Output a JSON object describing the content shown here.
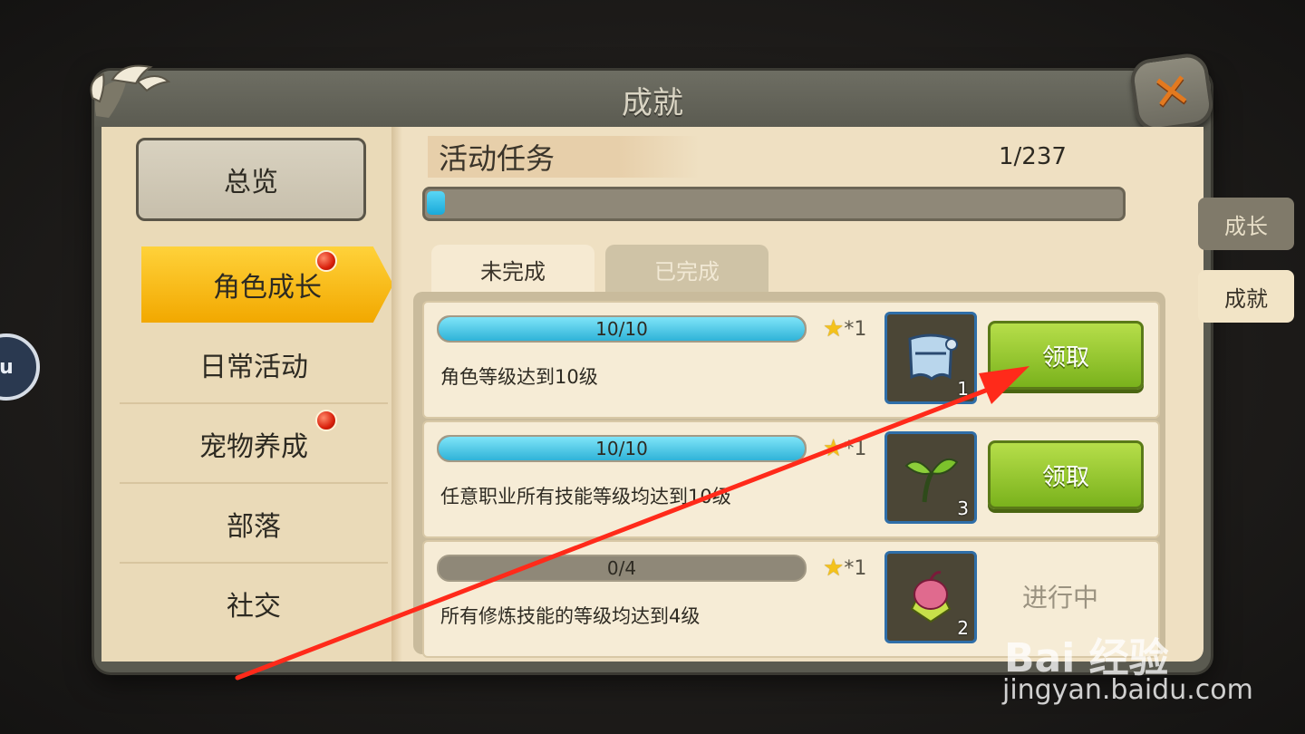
{
  "window": {
    "title": "成就"
  },
  "sidebar": {
    "overview_label": "总览",
    "items": [
      {
        "label": "角色成长",
        "active": true,
        "notification": true
      },
      {
        "label": "日常活动",
        "active": false,
        "notification": false
      },
      {
        "label": "宠物养成",
        "active": false,
        "notification": true
      },
      {
        "label": "部落",
        "active": false,
        "notification": false
      },
      {
        "label": "社交",
        "active": false,
        "notification": false
      }
    ]
  },
  "main": {
    "section_title": "活动任务",
    "progress_text": "1/237",
    "progress_value": 1,
    "progress_max": 237,
    "tabs": [
      {
        "label": "未完成",
        "active": true
      },
      {
        "label": "已完成",
        "active": false
      }
    ],
    "tasks": [
      {
        "progress_text": "10/10",
        "progress": 1.0,
        "description": "角色等级达到10级",
        "reward_text": "*1",
        "item_icon": "scroll-banner-icon",
        "item_count": "1",
        "action": "领取"
      },
      {
        "progress_text": "10/10",
        "progress": 1.0,
        "description": "任意职业所有技能等级均达到10级",
        "reward_text": "*1",
        "item_icon": "sprout-icon",
        "item_count": "3",
        "action": "领取"
      },
      {
        "progress_text": "0/4",
        "progress": 0.0,
        "description": "所有修炼技能的等级均达到4级",
        "reward_text": "*1",
        "item_icon": "flower-bulb-icon",
        "item_count": "2",
        "status": "进行中"
      }
    ]
  },
  "side_tabs": [
    {
      "label": "成长",
      "active": false
    },
    {
      "label": "成就",
      "active": true
    }
  ],
  "float_icon": {
    "label": "u"
  },
  "watermark": {
    "logo": "Bai  经验",
    "url": "jingyan.baidu.com"
  },
  "colors": {
    "accent_yellow": "#f2a800",
    "claim_green": "#7ab21c",
    "progress_blue": "#19a9d9",
    "close_orange": "#e3791f",
    "arrow_red": "#ff2a1a"
  }
}
